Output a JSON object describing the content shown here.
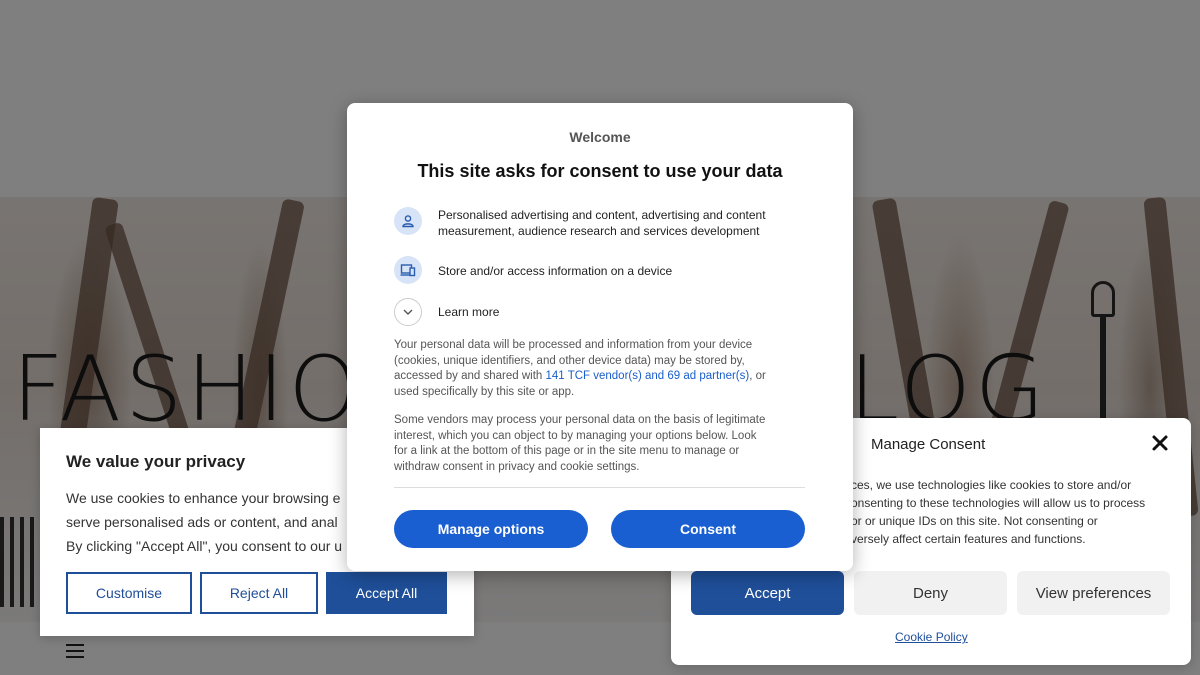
{
  "page": {
    "hero_title": "FASHION NEWS BLOG"
  },
  "privacy_banner": {
    "title": "We value your privacy",
    "lines": [
      "We use cookies to enhance your browsing e",
      "serve personalised ads or content, and anal",
      "By clicking \"Accept All\", you consent to our u"
    ],
    "customise_label": "Customise",
    "reject_label": "Reject All",
    "accept_label": "Accept All"
  },
  "consent_manager": {
    "title": "Manage Consent",
    "lines": [
      "ces, we use technologies like cookies to store and/or",
      "onsenting to these technologies will allow us to process",
      "or or unique IDs on this site. Not consenting or",
      "versely affect certain features and functions."
    ],
    "accept_label": "Accept",
    "deny_label": "Deny",
    "view_preferences_label": "View preferences",
    "cookie_policy_label": "Cookie Policy"
  },
  "modal": {
    "welcome": "Welcome",
    "heading": "This site asks for consent to use your data",
    "purposes": [
      {
        "icon": "person-icon",
        "lines": [
          "Personalised advertising and content, advertising and content",
          "measurement, audience research and services development"
        ]
      },
      {
        "icon": "device-icon",
        "lines": [
          "Store and/or access information on a device"
        ]
      }
    ],
    "learn_more_label": "Learn more",
    "paragraph1": {
      "line1": "Your personal data will be processed and information from your device",
      "line2": "(cookies, unique identifiers, and other device data) may be stored by,",
      "line3_before": "accessed by and shared with ",
      "vendor_link": "141 TCF vendor(s) and 69 ad partner(s)",
      "line3_after": ", or",
      "line4": "used specifically by this site or app."
    },
    "paragraph2": [
      "Some vendors may process your personal data on the basis of legitimate",
      "interest, which you can object to by managing your options below. Look",
      "for a link at the bottom of this page or in the site menu to manage or",
      "withdraw consent in privacy and cookie settings."
    ],
    "manage_options_label": "Manage options",
    "consent_label": "Consent"
  },
  "colors": {
    "modal_button": "#1a5fd1",
    "banner_button": "#1f4f99",
    "link": "#1a5ec9"
  }
}
